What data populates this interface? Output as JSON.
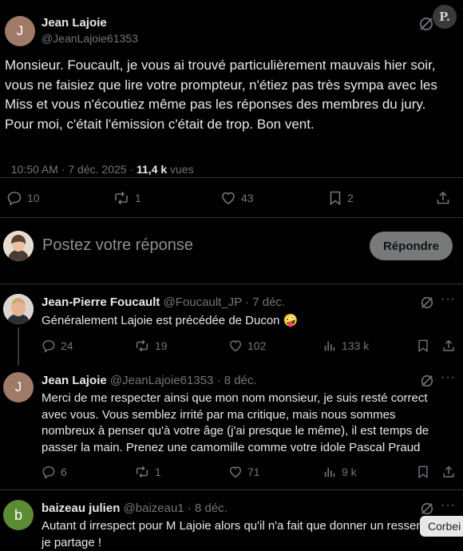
{
  "main_tweet": {
    "author_initial": "J",
    "author_name": "Jean Lajoie",
    "author_handle": "@JeanLajoie61353",
    "text": "Monsieur. Foucault, je vous ai trouvé particulièrement mauvais hier soir, vous ne faisiez que lire votre prompteur, n'étiez pas très sympa avec les Miss et vous n'écoutiez même pas les réponses des membres du jury. Pour moi, c'était l'émission c'était de trop. Bon vent.",
    "time": "10:50 AM · 7 déc. 2025 · ",
    "views_count": "11,4 k",
    "views_label": " vues",
    "replies": "10",
    "reposts": "1",
    "likes": "43",
    "bookmarks": "2"
  },
  "corner_badge": "P.",
  "composer": {
    "placeholder": "Postez votre réponse",
    "reply_button": "Répondre"
  },
  "replies": [
    {
      "author_name": "Jean-Pierre Foucault",
      "handle_date": "@Foucault_JP · 7 déc.",
      "text": "Généralement Lajoie est précédée de Ducon 🤪",
      "replies": "24",
      "reposts": "19",
      "likes": "102",
      "views": "133 k"
    },
    {
      "author_initial": "J",
      "author_name": "Jean Lajoie",
      "handle_date": "@JeanLajoie61353 · 8 déc.",
      "text": "Merci de me respecter ainsi que mon nom monsieur, je suis resté correct avec vous. Vous semblez irrité par ma critique, mais nous sommes nombreux à penser qu'à votre âge (j'ai presque le même), il est temps de passer la main.  Prenez une camomille comme votre idole Pascal Praud",
      "replies": "6",
      "reposts": "1",
      "likes": "71",
      "views": "9 k"
    },
    {
      "author_initial": "b",
      "author_name": "baizeau julien",
      "handle_date": "@baizeau1 · 8 déc.",
      "text": "Autant d irrespect pour M Lajoie alors qu'il n'a fait que donner un ressenti que je partage !"
    }
  ],
  "watermark": "Corbei"
}
